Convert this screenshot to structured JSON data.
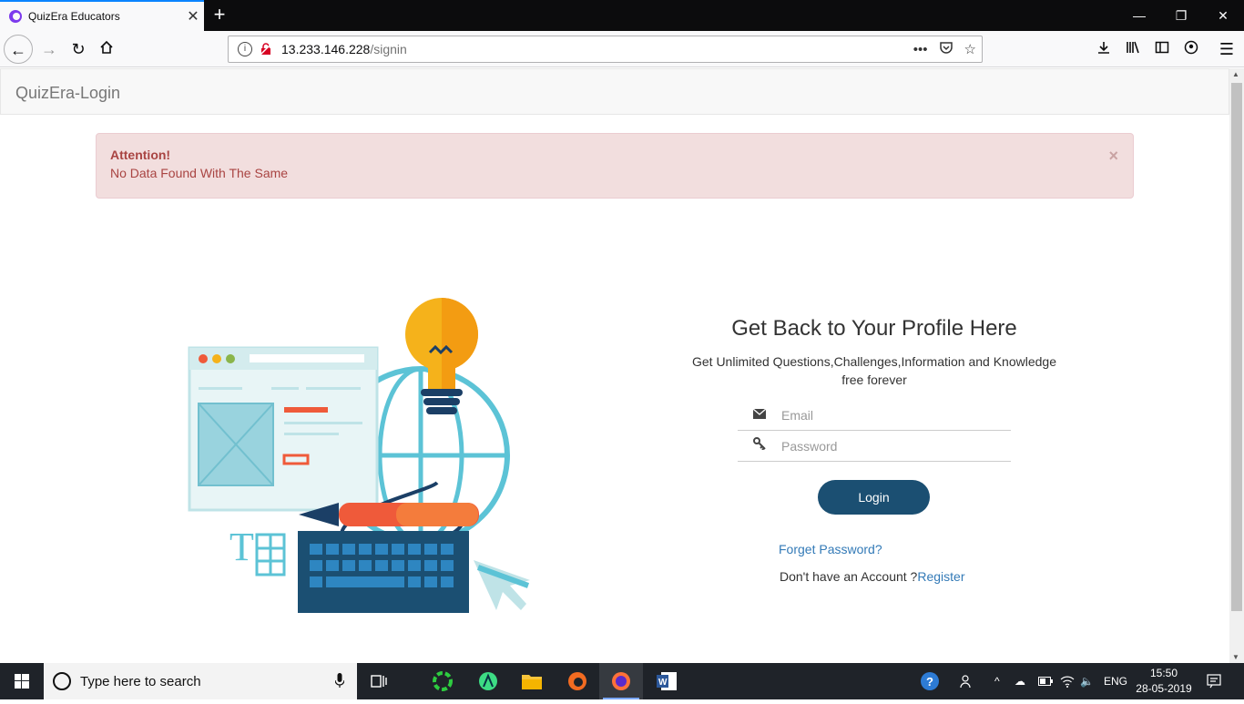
{
  "browser": {
    "tab_title": "QuizEra Educators",
    "url_host": "13.233.146.228",
    "url_path": "/signin"
  },
  "app": {
    "brand": "QuizEra-Login"
  },
  "alert": {
    "heading": "Attention!",
    "message": "No Data Found With The Same",
    "close_glyph": "×"
  },
  "login": {
    "title": "Get Back to Your Profile Here",
    "subtitle_line1": "Get Unlimited Questions,Challenges,Information and Knowledge",
    "subtitle_line2": "free forever",
    "email_placeholder": "Email",
    "password_placeholder": "Password",
    "login_button": "Login",
    "forgot_link": "Forget Password?",
    "no_account_text": "Don't have an Account ?",
    "register_link": "Register"
  },
  "taskbar": {
    "search_placeholder": "Type here to search",
    "language": "ENG",
    "time": "15:50",
    "date": "28-05-2019"
  },
  "colors": {
    "alert_bg": "#f2dede",
    "alert_text": "#a94442",
    "button_bg": "#1b4f72",
    "link": "#337ab7"
  }
}
